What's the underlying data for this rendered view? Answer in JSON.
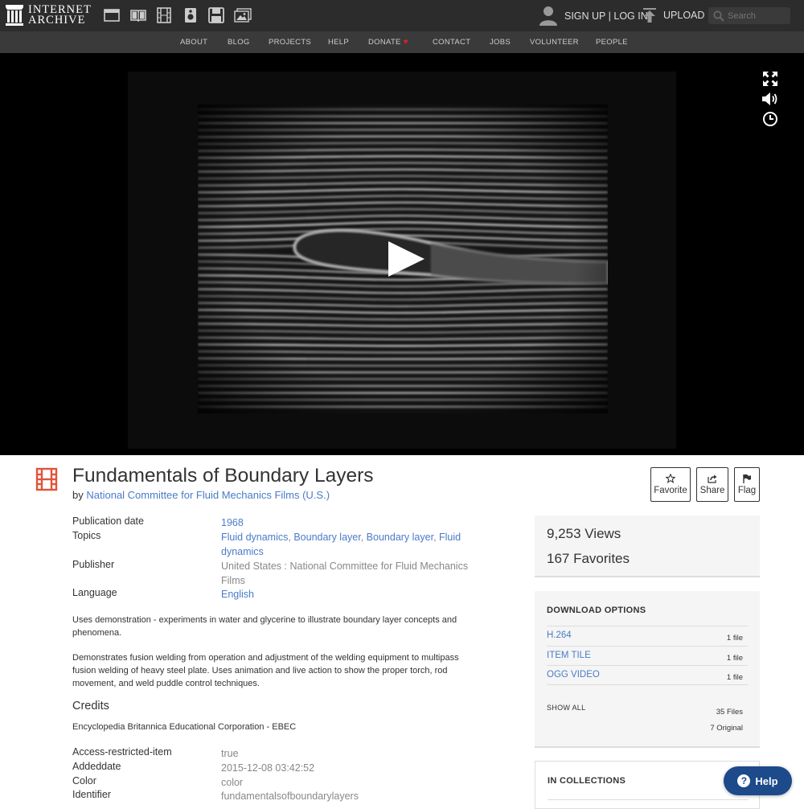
{
  "header": {
    "logo_line1": "INTERNET",
    "logo_line2": "ARCHIVE",
    "signup_label": "SIGN UP | LOG IN",
    "upload_label": "UPLOAD",
    "search_placeholder": "Search",
    "media_icons": [
      "web-icon",
      "texts-icon",
      "video-icon",
      "audio-icon",
      "software-icon",
      "images-icon"
    ]
  },
  "nav": {
    "items": [
      "ABOUT",
      "BLOG",
      "PROJECTS",
      "HELP",
      "DONATE",
      "CONTACT",
      "JOBS",
      "VOLUNTEER",
      "PEOPLE"
    ]
  },
  "player": {
    "controls": [
      "fullscreen-icon",
      "volume-icon",
      "clock-icon"
    ]
  },
  "item": {
    "title": "Fundamentals of Boundary Layers",
    "by_label": "by",
    "creator": "National Committee for Fluid Mechanics Films (U.S.)",
    "actions": {
      "favorite": "Favorite",
      "share": "Share",
      "flag": "Flag"
    }
  },
  "metadata": {
    "publication_date_label": "Publication date",
    "publication_date": "1968",
    "topics_label": "Topics",
    "topics": [
      "Fluid dynamics",
      "Boundary layer",
      "Boundary layer",
      "Fluid dynamics"
    ],
    "publisher_label": "Publisher",
    "publisher": "United States : National Committee for Fluid Mechanics Films",
    "language_label": "Language",
    "language": "English",
    "description_1": "Uses demonstration - experiments in water and glycerine to illustrate boundary layer concepts and phenomena.",
    "description_2": "Demonstrates fusion welding from operation and adjustment of the welding equipment to multipass fusion welding of heavy steel plate. Uses animation and live action to show the proper torch, rod movement, and weld puddle control techniques.",
    "credits_label": "Credits",
    "credits": "Encyclopedia Britannica Educational Corporation - EBEC",
    "access_label": "Access-restricted-item",
    "access": "true",
    "addeddate_label": "Addeddate",
    "addeddate": "2015-12-08 03:42:52",
    "color_label": "Color",
    "color": "color",
    "identifier_label": "Identifier",
    "identifier": "fundamentalsofboundarylayers"
  },
  "stats": {
    "views": "9,253 Views",
    "favorites": "167 Favorites"
  },
  "downloads": {
    "heading": "DOWNLOAD OPTIONS",
    "options": [
      {
        "format": "H.264",
        "count": "1 file"
      },
      {
        "format": "ITEM TILE",
        "count": "1 file"
      },
      {
        "format": "OGG VIDEO",
        "count": "1 file"
      }
    ],
    "show_all": "SHOW ALL",
    "total_files": "35 Files",
    "original": "7 Original"
  },
  "collections": {
    "heading": "IN COLLECTIONS"
  },
  "help": {
    "label": "Help"
  },
  "colors": {
    "link": "#4b7bc8",
    "topbar": "#2c2c2c",
    "nav": "#3a3a3a",
    "media_red": "#e2533b",
    "help_blue": "#1c4a8a"
  }
}
